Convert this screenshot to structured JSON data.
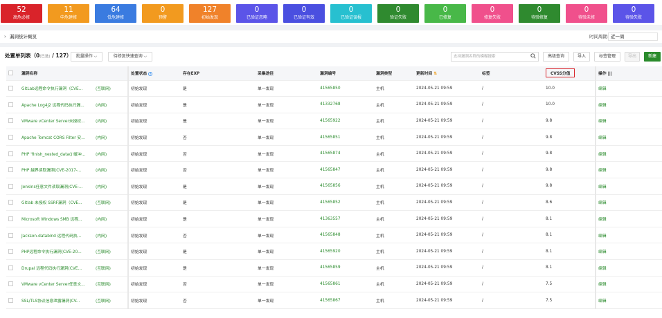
{
  "stats": [
    {
      "num": "52",
      "label": "高危必修",
      "color": "#d9232a"
    },
    {
      "num": "11",
      "label": "中危建修",
      "color": "#f29a1f"
    },
    {
      "num": "64",
      "label": "低危建修",
      "color": "#3a7be0"
    },
    {
      "num": "0",
      "label": "预警",
      "color": "#f29a1f"
    },
    {
      "num": "127",
      "label": "初始发现",
      "color": "#f0822a"
    },
    {
      "num": "0",
      "label": "已验证忽略",
      "color": "#5b54e8"
    },
    {
      "num": "0",
      "label": "已验证有效",
      "color": "#4a4fe0"
    },
    {
      "num": "0",
      "label": "已验证误报",
      "color": "#27c0d0"
    },
    {
      "num": "0",
      "label": "验证失败",
      "color": "#2f8a2f"
    },
    {
      "num": "0",
      "label": "已修复",
      "color": "#48b848"
    },
    {
      "num": "0",
      "label": "修复失败",
      "color": "#f0508c"
    },
    {
      "num": "0",
      "label": "待验修复",
      "color": "#2f8a2f"
    },
    {
      "num": "0",
      "label": "待验未修",
      "color": "#f0508c"
    },
    {
      "num": "0",
      "label": "待验失败",
      "color": "#5b54e8"
    }
  ],
  "summary": {
    "chev": "›",
    "title": "漏洞统计概览",
    "period_label": "时间周期:",
    "period_value": "近一周"
  },
  "toolbar": {
    "title": "处置单列表（0",
    "title_small": "(已选)",
    "title_tail": " / 127）",
    "bulk": "批量操作 ⌵",
    "quick": "待修复快速查询 ⌵",
    "search_placeholder": "支持漏洞名称的模糊搜索",
    "advanced": "高级查询",
    "import": "导入",
    "tags": "标签管理",
    "export": "导出",
    "new": "新建"
  },
  "columns": {
    "name": "漏洞名称",
    "status": "处置状态",
    "exp": "存在EXP",
    "path": "采集途径",
    "id": "漏洞编号",
    "type": "漏洞类型",
    "time": "更新时间",
    "tag": "标签",
    "cvss": "CVSS分值",
    "op": "操作 |||"
  },
  "rows": [
    {
      "name": "GitLab远程命令执行漏洞（CVE...",
      "net": "(互联网)",
      "status": "初始发现",
      "exp": "是",
      "path": "单一发现",
      "id": "41565850",
      "type": "主机",
      "time": "2024-05-21 09:59",
      "tag": "/",
      "cvss": "10.0",
      "op": "编辑"
    },
    {
      "name": "Apache Log4j2 远程代码执行漏...",
      "net": "(内网)",
      "status": "初始发现",
      "exp": "是",
      "path": "单一发现",
      "id": "41332768",
      "type": "主机",
      "time": "2024-05-21 09:59",
      "tag": "/",
      "cvss": "10.0",
      "op": "编辑"
    },
    {
      "name": "VMware vCenter Server未授权...",
      "net": "(内网)",
      "status": "初始发现",
      "exp": "是",
      "path": "单一发现",
      "id": "41565922",
      "type": "主机",
      "time": "2024-05-21 09:59",
      "tag": "/",
      "cvss": "9.8",
      "op": "编辑"
    },
    {
      "name": "Apache Tomcat CORS Filter 安...",
      "net": "(内网)",
      "status": "初始发现",
      "exp": "否",
      "path": "单一发现",
      "id": "41565851",
      "type": "主机",
      "time": "2024-05-21 09:59",
      "tag": "/",
      "cvss": "9.8",
      "op": "编辑"
    },
    {
      "name": "PHP 'finish_nested_data()'缓冲...",
      "net": "(内网)",
      "status": "初始发现",
      "exp": "否",
      "path": "单一发现",
      "id": "41565874",
      "type": "主机",
      "time": "2024-05-21 09:59",
      "tag": "/",
      "cvss": "9.8",
      "op": "编辑"
    },
    {
      "name": "PHP 越界读取漏洞(CVE-2017-...",
      "net": "(内网)",
      "status": "初始发现",
      "exp": "否",
      "path": "单一发现",
      "id": "41565847",
      "type": "主机",
      "time": "2024-05-21 09:59",
      "tag": "/",
      "cvss": "9.8",
      "op": "编辑"
    },
    {
      "name": "Jenkins任意文件读取漏洞(CVE-...",
      "net": "(内网)",
      "status": "初始发现",
      "exp": "是",
      "path": "单一发现",
      "id": "41565856",
      "type": "主机",
      "time": "2024-05-21 09:59",
      "tag": "/",
      "cvss": "9.8",
      "op": "编辑"
    },
    {
      "name": "Gitlab 未授权 SSRF漏洞（CVE...",
      "net": "(互联网)",
      "status": "初始发现",
      "exp": "是",
      "path": "单一发现",
      "id": "41565852",
      "type": "主机",
      "time": "2024-05-21 09:59",
      "tag": "/",
      "cvss": "8.6",
      "op": "编辑"
    },
    {
      "name": "Microsoft Windows SMB 远程...",
      "net": "(内网)",
      "status": "初始发现",
      "exp": "是",
      "path": "单一发现",
      "id": "41363557",
      "type": "主机",
      "time": "2024-05-21 09:59",
      "tag": "/",
      "cvss": "8.1",
      "op": "编辑"
    },
    {
      "name": "Jackson-databind 远程代码执...",
      "net": "(内网)",
      "status": "初始发现",
      "exp": "否",
      "path": "单一发现",
      "id": "41565848",
      "type": "主机",
      "time": "2024-05-21 09:59",
      "tag": "/",
      "cvss": "8.1",
      "op": "编辑"
    },
    {
      "name": "PHP远程命令执行漏洞(CVE-20...",
      "net": "(互联网)",
      "status": "初始发现",
      "exp": "是",
      "path": "单一发现",
      "id": "41565920",
      "type": "主机",
      "time": "2024-05-21 09:59",
      "tag": "/",
      "cvss": "8.1",
      "op": "编辑"
    },
    {
      "name": "Drupal 远程代码执行漏洞(CVE...",
      "net": "(互联网)",
      "status": "初始发现",
      "exp": "是",
      "path": "单一发现",
      "id": "41565859",
      "type": "主机",
      "time": "2024-05-21 09:59",
      "tag": "/",
      "cvss": "8.1",
      "op": "编辑"
    },
    {
      "name": "VMware vCenter Server任意文...",
      "net": "(互联网)",
      "status": "初始发现",
      "exp": "否",
      "path": "单一发现",
      "id": "41565861",
      "type": "主机",
      "time": "2024-05-21 09:59",
      "tag": "/",
      "cvss": "7.5",
      "op": "编辑"
    },
    {
      "name": "SSL/TLS协议信息泄露漏洞(CV...",
      "net": "(互联网)",
      "status": "初始发现",
      "exp": "否",
      "path": "单一发现",
      "id": "41565867",
      "type": "主机",
      "time": "2024-05-21 09:59",
      "tag": "/",
      "cvss": "7.5",
      "op": "编辑"
    }
  ]
}
